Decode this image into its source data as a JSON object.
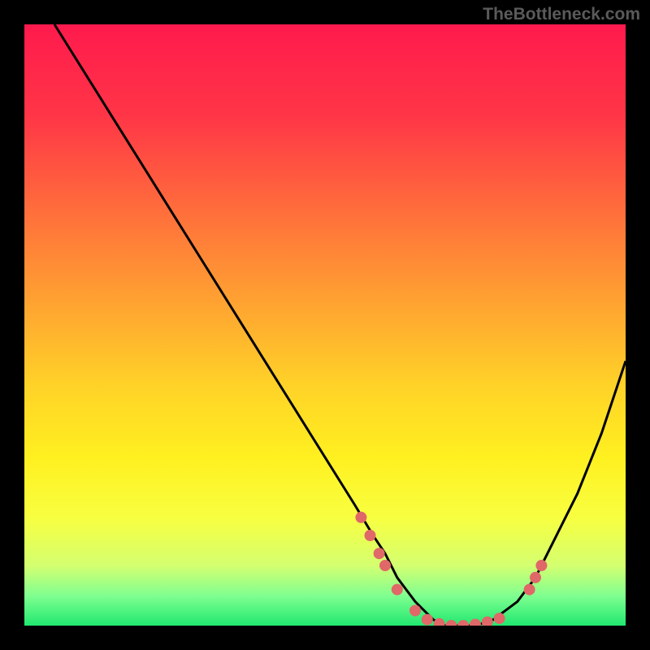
{
  "watermark": "TheBottleneck.com",
  "chart_data": {
    "type": "line",
    "title": "",
    "xlabel": "",
    "ylabel": "",
    "xlim": [
      0,
      100
    ],
    "ylim": [
      0,
      100
    ],
    "series": [
      {
        "name": "curve",
        "x": [
          5,
          10,
          15,
          20,
          25,
          30,
          35,
          40,
          45,
          50,
          55,
          58,
          60,
          62,
          65,
          68,
          70,
          72,
          75,
          78,
          82,
          85,
          88,
          92,
          96,
          100
        ],
        "y": [
          100,
          92,
          84,
          76,
          68,
          60,
          52,
          44,
          36,
          28,
          20,
          15,
          12,
          8,
          4,
          1,
          0,
          0,
          0,
          1,
          4,
          8,
          14,
          22,
          32,
          44
        ],
        "markers": [
          {
            "x": 56,
            "y": 18
          },
          {
            "x": 57.5,
            "y": 15
          },
          {
            "x": 59,
            "y": 12
          },
          {
            "x": 60,
            "y": 10
          },
          {
            "x": 62,
            "y": 6
          },
          {
            "x": 65,
            "y": 2.5
          },
          {
            "x": 67,
            "y": 1
          },
          {
            "x": 69,
            "y": 0.3
          },
          {
            "x": 71,
            "y": 0
          },
          {
            "x": 73,
            "y": 0
          },
          {
            "x": 75,
            "y": 0.2
          },
          {
            "x": 77,
            "y": 0.6
          },
          {
            "x": 79,
            "y": 1.2
          },
          {
            "x": 84,
            "y": 6
          },
          {
            "x": 85,
            "y": 8
          },
          {
            "x": 86,
            "y": 10
          }
        ]
      }
    ],
    "gradient_stops": [
      {
        "offset": 0.0,
        "color": "#ff1a4d"
      },
      {
        "offset": 0.15,
        "color": "#ff3547"
      },
      {
        "offset": 0.3,
        "color": "#ff6a3c"
      },
      {
        "offset": 0.45,
        "color": "#ff9e32"
      },
      {
        "offset": 0.6,
        "color": "#ffd228"
      },
      {
        "offset": 0.72,
        "color": "#fff020"
      },
      {
        "offset": 0.82,
        "color": "#f8ff40"
      },
      {
        "offset": 0.9,
        "color": "#d4ff70"
      },
      {
        "offset": 0.95,
        "color": "#80ff90"
      },
      {
        "offset": 1.0,
        "color": "#20e870"
      }
    ],
    "marker_color": "#e06868",
    "curve_color": "#000000"
  }
}
